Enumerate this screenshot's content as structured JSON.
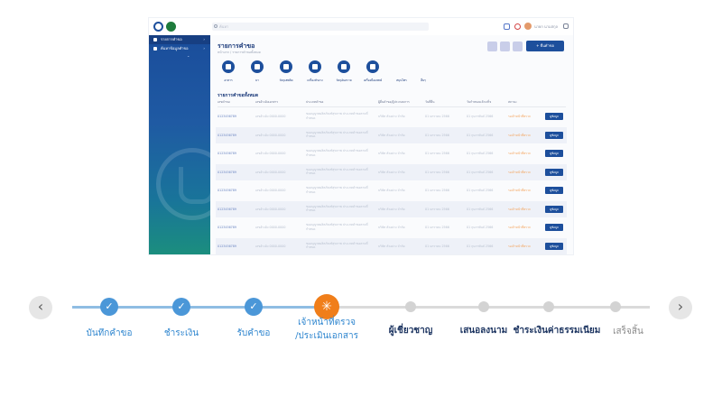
{
  "app": {
    "search_placeholder": "ค้นหา",
    "username": "นายก นามสกุล",
    "page_title": "รายการคำขอ",
    "page_subtitle": "หน้าแรก / รายการคำขอทั้งหมด",
    "add_button": "+ ยื่นคำขอ",
    "sidebar": [
      {
        "label": "รายการคำขอ",
        "active": true
      },
      {
        "label": "ค้นหาข้อมูลคำขอ",
        "active": false
      }
    ],
    "categories": [
      "อาหาร",
      "ยา",
      "วัตถุเสพติด",
      "เครื่องสำอาง",
      "วัตถุอันตราย",
      "เครื่องมือแพทย์",
      "สมุนไพร",
      "อื่นๆ"
    ],
    "table": {
      "title": "รายการคำขอทั้งหมด",
      "columns": [
        "เลขคำขอ",
        "เลขอ้างอิงเอกสาร",
        "ประเภทคำขอ",
        "ผู้ยื่นคำขอ/ผู้ประกอบการ",
        "วันที่ยื่น",
        "วันกำหนดแล้วเสร็จ",
        "สถานะ",
        ""
      ],
      "rows": [
        {
          "id": "0123456789",
          "ref": "เลขอ้างอิง 0000-0000",
          "desc": "ขออนุญาตผลิตภัณฑ์สุขภาพ ประเภทคำขอตามที่กำหนด",
          "applicant": "บริษัท ตัวอย่าง จำกัด",
          "submitted": "01 มกราคม 2566",
          "due": "01 กุมภาพันธ์ 2566",
          "status": "รอเจ้าหน้าที่ตรวจ",
          "action": "ดูข้อมูล"
        },
        {
          "id": "0123456789",
          "ref": "เลขอ้างอิง 0000-0000",
          "desc": "ขออนุญาตผลิตภัณฑ์สุขภาพ ประเภทคำขอตามที่กำหนด",
          "applicant": "บริษัท ตัวอย่าง จำกัด",
          "submitted": "01 มกราคม 2566",
          "due": "01 กุมภาพันธ์ 2566",
          "status": "รอเจ้าหน้าที่ตรวจ",
          "action": "ดูข้อมูล"
        },
        {
          "id": "0123456789",
          "ref": "เลขอ้างอิง 0000-0000",
          "desc": "ขออนุญาตผลิตภัณฑ์สุขภาพ ประเภทคำขอตามที่กำหนด",
          "applicant": "บริษัท ตัวอย่าง จำกัด",
          "submitted": "01 มกราคม 2566",
          "due": "01 กุมภาพันธ์ 2566",
          "status": "รอเจ้าหน้าที่ตรวจ",
          "action": "ดูข้อมูล"
        },
        {
          "id": "0123456789",
          "ref": "เลขอ้างอิง 0000-0000",
          "desc": "ขออนุญาตผลิตภัณฑ์สุขภาพ ประเภทคำขอตามที่กำหนด",
          "applicant": "บริษัท ตัวอย่าง จำกัด",
          "submitted": "01 มกราคม 2566",
          "due": "01 กุมภาพันธ์ 2566",
          "status": "รอเจ้าหน้าที่ตรวจ",
          "action": "ดูข้อมูล"
        },
        {
          "id": "0123456789",
          "ref": "เลขอ้างอิง 0000-0000",
          "desc": "ขออนุญาตผลิตภัณฑ์สุขภาพ ประเภทคำขอตามที่กำหนด",
          "applicant": "บริษัท ตัวอย่าง จำกัด",
          "submitted": "01 มกราคม 2566",
          "due": "01 กุมภาพันธ์ 2566",
          "status": "รอเจ้าหน้าที่ตรวจ",
          "action": "ดูข้อมูล"
        },
        {
          "id": "0123456789",
          "ref": "เลขอ้างอิง 0000-0000",
          "desc": "ขออนุญาตผลิตภัณฑ์สุขภาพ ประเภทคำขอตามที่กำหนด",
          "applicant": "บริษัท ตัวอย่าง จำกัด",
          "submitted": "01 มกราคม 2566",
          "due": "01 กุมภาพันธ์ 2566",
          "status": "รอเจ้าหน้าที่ตรวจ",
          "action": "ดูข้อมูล"
        },
        {
          "id": "0123456789",
          "ref": "เลขอ้างอิง 0000-0000",
          "desc": "ขออนุญาตผลิตภัณฑ์สุขภาพ ประเภทคำขอตามที่กำหนด",
          "applicant": "บริษัท ตัวอย่าง จำกัด",
          "submitted": "01 มกราคม 2566",
          "due": "01 กุมภาพันธ์ 2566",
          "status": "รอเจ้าหน้าที่ตรวจ",
          "action": "ดูข้อมูล"
        },
        {
          "id": "0123456789",
          "ref": "เลขอ้างอิง 0000-0000",
          "desc": "ขออนุญาตผลิตภัณฑ์สุขภาพ ประเภทคำขอตามที่กำหนด",
          "applicant": "บริษัท ตัวอย่าง จำกัด",
          "submitted": "01 มกราคม 2566",
          "due": "01 กุมภาพันธ์ 2566",
          "status": "รอเจ้าหน้าที่ตรวจ",
          "action": "ดูข้อมูล"
        }
      ]
    }
  },
  "stepper": {
    "prev_icon": "‹",
    "next_icon": "›",
    "steps": [
      {
        "label": "บันทึกคำขอ",
        "state": "done",
        "icon": "check-icon"
      },
      {
        "label": "ชำระเงิน",
        "state": "done",
        "icon": "check-icon"
      },
      {
        "label": "รับคำขอ",
        "state": "done",
        "icon": "check-icon"
      },
      {
        "label_line1": "เจ้าหน้าที่ตรวจ",
        "label_line2": "/ประเมินเอกสาร",
        "state": "current",
        "icon": "loading-spinner-icon"
      },
      {
        "label": "ผู้เชี่ยวชาญ",
        "state": "pending"
      },
      {
        "label": "เสนอลงนาม",
        "state": "pending"
      },
      {
        "label": "ชำระเงินค่าธรรมเนียม",
        "state": "pending"
      },
      {
        "label": "เสร็จสิ้น",
        "state": "pending"
      }
    ],
    "colors": {
      "done": "#4b97d8",
      "current": "#f07e1a",
      "pending": "#d3d3d3",
      "label_active": "#2f86cf",
      "label_bold": "#1d3561"
    }
  }
}
